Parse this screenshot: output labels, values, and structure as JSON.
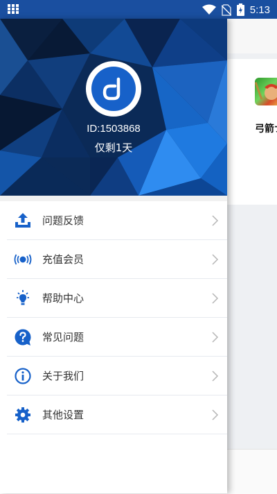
{
  "status_bar": {
    "time": "5:13",
    "icons": [
      "apps-grid-icon",
      "wifi-icon",
      "no-sim-icon",
      "battery-charging-icon"
    ]
  },
  "background_app": {
    "game_title": "弓箭ナ"
  },
  "drawer": {
    "user_id": "ID:1503868",
    "remaining": "仅剩1天",
    "menu": [
      {
        "label": "问题反馈",
        "icon": "upload-feedback-icon"
      },
      {
        "label": "充值会员",
        "icon": "vip-signal-icon"
      },
      {
        "label": "帮助中心",
        "icon": "lightbulb-icon"
      },
      {
        "label": "常见问题",
        "icon": "question-bubble-icon"
      },
      {
        "label": "关于我们",
        "icon": "info-icon"
      },
      {
        "label": "其他设置",
        "icon": "gear-icon"
      }
    ]
  },
  "colors": {
    "accent": "#1761c9",
    "status_bar": "#1a4fa0",
    "header_dark": "#0a1f3f",
    "header_light": "#1f7ae0"
  }
}
